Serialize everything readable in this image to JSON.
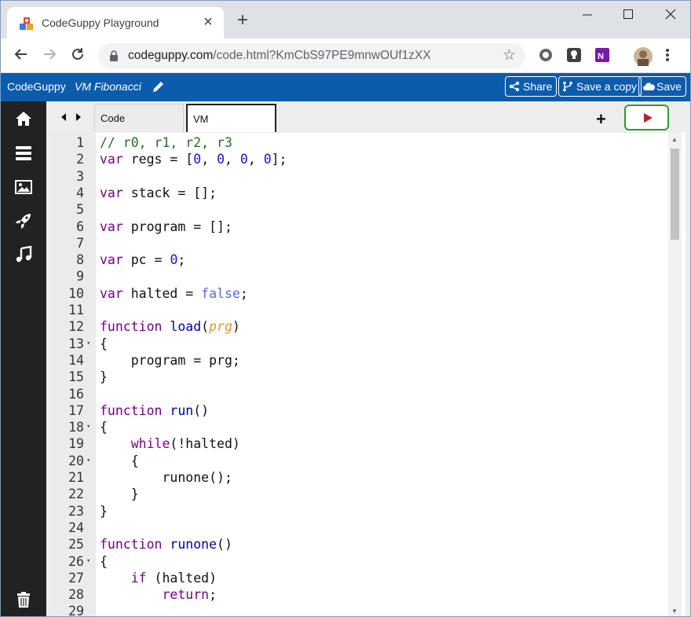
{
  "browser": {
    "tab_title": "CodeGuppy Playground",
    "tab_close": "×",
    "new_tab": "+",
    "url_host": "codeguppy.com",
    "url_path": "/code.html?KmCbS97PE9mnwOUf1zXX"
  },
  "app": {
    "brand": "CodeGuppy",
    "project_name": "VM Fibonacci",
    "buttons": {
      "share": "Share",
      "save_copy": "Save a copy",
      "save": "Save"
    }
  },
  "editor": {
    "tabs": [
      "Code",
      "VM"
    ],
    "active_tab": "VM",
    "add_label": "+",
    "lines": [
      {
        "n": "1",
        "fold": "",
        "html": "<span class='cm'>// r0, r1, r2, r3</span>"
      },
      {
        "n": "2",
        "fold": "",
        "html": "<span class='kw'>var</span> <span class='def'>regs</span> = [<span class='num'>0</span>, <span class='num'>0</span>, <span class='num'>0</span>, <span class='num'>0</span>];"
      },
      {
        "n": "3",
        "fold": "",
        "html": ""
      },
      {
        "n": "4",
        "fold": "",
        "html": "<span class='kw'>var</span> <span class='def'>stack</span> = [];"
      },
      {
        "n": "5",
        "fold": "",
        "html": ""
      },
      {
        "n": "6",
        "fold": "",
        "html": "<span class='kw'>var</span> <span class='def'>program</span> = [];"
      },
      {
        "n": "7",
        "fold": "",
        "html": ""
      },
      {
        "n": "8",
        "fold": "",
        "html": "<span class='kw'>var</span> <span class='def'>pc</span> = <span class='num'>0</span>;"
      },
      {
        "n": "9",
        "fold": "",
        "html": ""
      },
      {
        "n": "10",
        "fold": "",
        "html": "<span class='kw'>var</span> <span class='def'>halted</span> = <span class='atom'>false</span>;"
      },
      {
        "n": "11",
        "fold": "",
        "html": ""
      },
      {
        "n": "12",
        "fold": "",
        "html": "<span class='kw'>function</span> <span class='fn'>load</span>(<span class='param'>prg</span>)"
      },
      {
        "n": "13",
        "fold": "▾",
        "html": "{"
      },
      {
        "n": "14",
        "fold": "",
        "html": "    program = prg;"
      },
      {
        "n": "15",
        "fold": "",
        "html": "}"
      },
      {
        "n": "16",
        "fold": "",
        "html": ""
      },
      {
        "n": "17",
        "fold": "",
        "html": "<span class='kw'>function</span> <span class='fn'>run</span>()"
      },
      {
        "n": "18",
        "fold": "▾",
        "html": "{"
      },
      {
        "n": "19",
        "fold": "",
        "html": "    <span class='kw'>while</span>(!halted)"
      },
      {
        "n": "20",
        "fold": "▾",
        "html": "    {"
      },
      {
        "n": "21",
        "fold": "",
        "html": "        runone();"
      },
      {
        "n": "22",
        "fold": "",
        "html": "    }"
      },
      {
        "n": "23",
        "fold": "",
        "html": "}"
      },
      {
        "n": "24",
        "fold": "",
        "html": ""
      },
      {
        "n": "25",
        "fold": "",
        "html": "<span class='kw'>function</span> <span class='fn'>runone</span>()"
      },
      {
        "n": "26",
        "fold": "▾",
        "html": "{"
      },
      {
        "n": "27",
        "fold": "",
        "html": "    <span class='kw'>if</span> (halted)"
      },
      {
        "n": "28",
        "fold": "",
        "html": "        <span class='kw'>return</span>;"
      },
      {
        "n": "29",
        "fold": "",
        "html": ""
      }
    ]
  },
  "colors": {
    "app_header": "#0b5cad",
    "sidebar": "#222222",
    "run_border": "#2e9a36",
    "run_icon": "#b0232a"
  },
  "icons": {
    "sidebar": [
      "home-icon",
      "menu-icon",
      "image-icon",
      "rocket-icon",
      "music-icon",
      "trash-icon"
    ]
  }
}
